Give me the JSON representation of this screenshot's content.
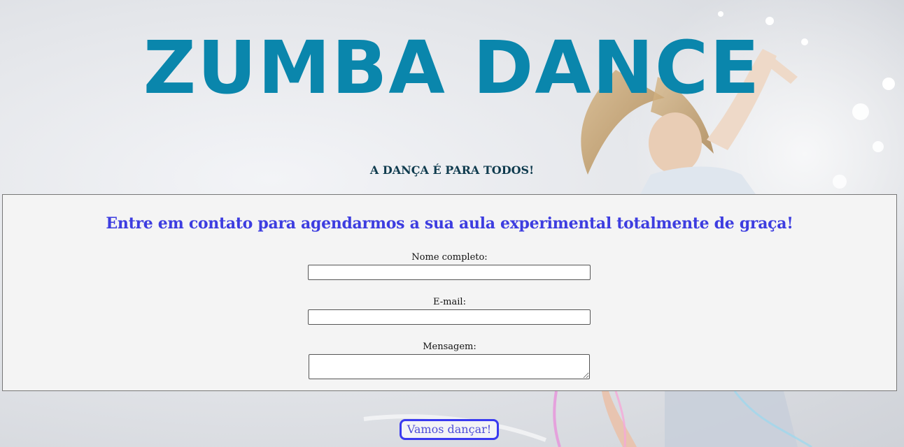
{
  "header": {
    "title": "ZUMBA DANCE",
    "tagline": "A DANÇA É PARA TODOS!"
  },
  "contact": {
    "heading": "Entre em contato para agendarmos a sua aula experimental totalmente de graça!",
    "fields": [
      {
        "label": "Nome completo:",
        "value": "",
        "placeholder": ""
      },
      {
        "label": "E-mail:",
        "value": "",
        "placeholder": ""
      },
      {
        "label": "Mensagem:",
        "value": "",
        "placeholder": ""
      }
    ]
  },
  "submit": {
    "label": "Vamos dançar!"
  },
  "background": {
    "image": "dancer-photo"
  },
  "colors": {
    "title": "#0a86ac",
    "tagline": "#0f3b4e",
    "heading": "#3d3de0",
    "button_border": "#3a3af0",
    "panel": "#f4f4f4"
  }
}
